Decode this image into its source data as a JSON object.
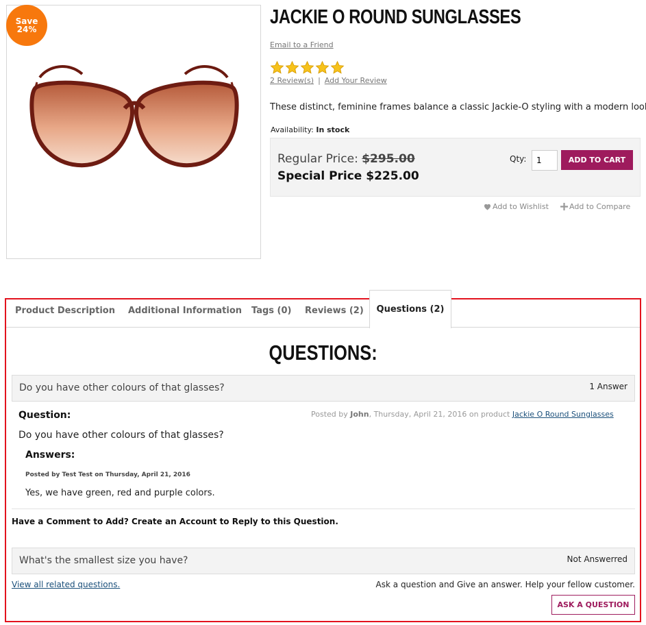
{
  "product": {
    "save_line1": "Save",
    "save_line2": "24%",
    "title": "JACKIE O ROUND SUNGLASSES",
    "email_friend": "Email to a Friend",
    "rating_stars": 5,
    "reviews_link": "2 Review(s)",
    "review_separator": "|",
    "add_review_link": "Add Your Review",
    "description": "These distinct, feminine frames balance a classic Jackie-O styling with a modern look.",
    "availability_label": "Availability:",
    "availability_value": "In stock",
    "regular_price_label": "Regular Price:",
    "regular_price_value": "$295.00",
    "special_price_label": "Special Price",
    "special_price_value": "$225.00",
    "qty_label": "Qty:",
    "qty_value": "1",
    "add_to_cart": "ADD TO CART",
    "wishlist": "Add to Wishlist",
    "compare": "Add to Compare"
  },
  "tabs": [
    {
      "label": "Product Description"
    },
    {
      "label": "Additional Information"
    },
    {
      "label": "Tags (0)"
    },
    {
      "label": "Reviews (2)"
    },
    {
      "label": "Questions (2)"
    }
  ],
  "questions_section": {
    "heading": "QUESTIONS:",
    "questions": [
      {
        "title": "Do you have other colours of that glasses?",
        "status": "1 Answer",
        "question_label": "Question:",
        "posted_prefix": "Posted by",
        "posted_author": "John",
        "posted_date": ", Thursday, April 21, 2016 on product",
        "posted_product": "Jackie O Round Sunglasses",
        "body": "Do you have other colours of that glasses?",
        "answers_label": "Answers:",
        "answer_posted": "Posted by Test Test on Thursday, April 21, 2016",
        "answer_body": "Yes, we have green, red and purple colors."
      },
      {
        "title": "What's the smallest size you have?",
        "status": "Not Answerred"
      }
    ],
    "comment_prompt": "Have a Comment to Add? Create an Account to Reply to this Question.",
    "view_all": "View all related questions.",
    "help_text": "Ask a question and Give an answer. Help your fellow customer.",
    "ask_button": "ASK A QUESTION"
  },
  "colors": {
    "accent": "#9e1b5d",
    "badge": "#f7780d",
    "highlight_frame": "#e3121d",
    "star": "#f6c21c"
  }
}
